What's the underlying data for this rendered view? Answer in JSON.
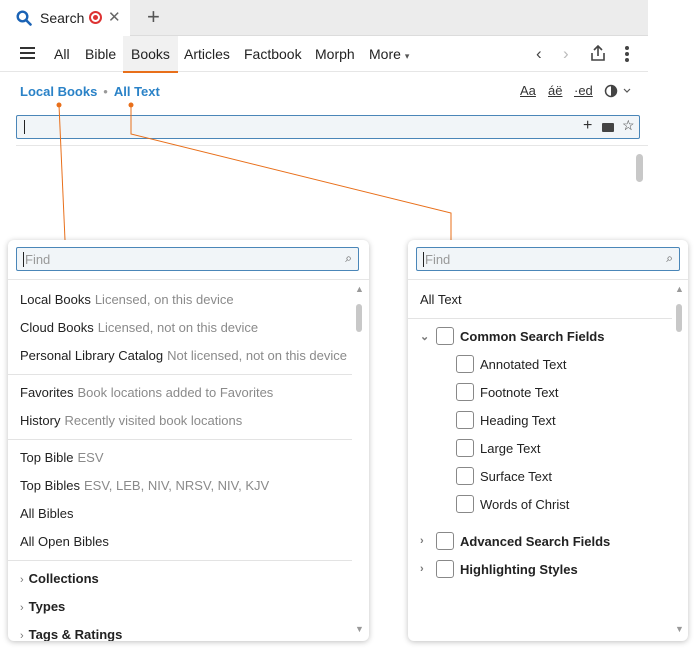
{
  "tab": {
    "title": "Search"
  },
  "nav": {
    "tabs": [
      "All",
      "Bible",
      "Books",
      "Articles",
      "Factbook",
      "Morph",
      "More"
    ],
    "active": "Books"
  },
  "scope": {
    "books": "Local Books",
    "fields": "All Text"
  },
  "tools": {
    "case": "Aa",
    "accents": "áë",
    "forms": "·ed"
  },
  "search": {
    "value": ""
  },
  "left_popup": {
    "find_placeholder": "Find",
    "sources": [
      {
        "name": "Local Books",
        "desc": "Licensed, on this device"
      },
      {
        "name": "Cloud Books",
        "desc": "Licensed, not on this device"
      },
      {
        "name": "Personal Library Catalog",
        "desc": "Not licensed, not on this device"
      }
    ],
    "recent": [
      {
        "name": "Favorites",
        "desc": "Book locations added to Favorites"
      },
      {
        "name": "History",
        "desc": "Recently visited book locations"
      }
    ],
    "bibles": [
      {
        "name": "Top Bible",
        "desc": "ESV"
      },
      {
        "name": "Top Bibles",
        "desc": "ESV, LEB, NIV, NRSV, NIV, KJV"
      },
      {
        "name": "All Bibles",
        "desc": ""
      },
      {
        "name": "All Open Bibles",
        "desc": ""
      }
    ],
    "groups": [
      "Collections",
      "Types",
      "Tags & Ratings"
    ]
  },
  "right_popup": {
    "find_placeholder": "Find",
    "all_label": "All Text",
    "common": {
      "label": "Common Search Fields",
      "items": [
        "Annotated Text",
        "Footnote Text",
        "Heading Text",
        "Large Text",
        "Surface Text",
        "Words of Christ"
      ]
    },
    "other_groups": [
      "Advanced Search Fields",
      "Highlighting Styles"
    ]
  },
  "colors": {
    "accent": "#e86f1a",
    "link": "#2a82c7",
    "focus_border": "#4a86b8"
  }
}
